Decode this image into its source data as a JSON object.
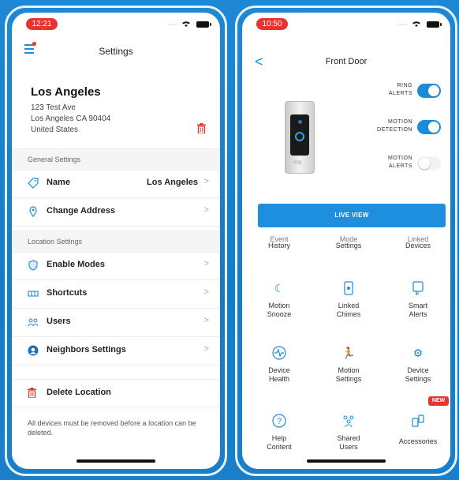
{
  "left": {
    "status_time": "12:21",
    "status_dots": "....",
    "nav_title": "Settings",
    "location": {
      "name": "Los Angeles",
      "address_line1": "123 Test Ave",
      "address_line2": "Los Angeles CA 90404",
      "address_line3": "United States"
    },
    "general_settings_header": "General Settings",
    "name_row": {
      "label": "Name",
      "value": "Los Angeles",
      "chevron": ">"
    },
    "change_address_row": {
      "label": "Change Address",
      "chevron": ">"
    },
    "location_settings_header": "Location Settings",
    "enable_modes_row": {
      "label": "Enable Modes",
      "chevron": ">"
    },
    "shortcuts_row": {
      "label": "Shortcuts",
      "chevron": ">"
    },
    "users_row": {
      "label": "Users",
      "chevron": ">"
    },
    "neighbors_row": {
      "label": "Neighbors Settings",
      "chevron": ">"
    },
    "delete_location_label": "Delete Location",
    "delete_note": "All devices must be removed before a location can be deleted."
  },
  "right": {
    "status_time": "10:50",
    "status_dots": "....",
    "nav_title": "Front Door",
    "back_glyph": "<",
    "doorbell_brand": "ring",
    "ring_alerts": {
      "label_1": "RING",
      "label_2": "ALERTS",
      "state": "on"
    },
    "motion_detection": {
      "label_1": "MOTION",
      "label_2": "DETECTION",
      "state": "on"
    },
    "motion_alerts": {
      "label_1": "MOTION",
      "label_2": "ALERTS",
      "state": "off"
    },
    "live_view_label": "LIVE VIEW",
    "tiles_row1": [
      {
        "cut": "Event",
        "label": "History"
      },
      {
        "cut": "Mode",
        "label": "Settings"
      },
      {
        "cut": "Linked",
        "label": "Devices"
      }
    ],
    "tiles_row2": [
      {
        "label_1": "Motion",
        "label_2": "Snooze",
        "icon": "moon-icon"
      },
      {
        "label_1": "Linked",
        "label_2": "Chimes",
        "icon": "chime-icon"
      },
      {
        "label_1": "Smart",
        "label_2": "Alerts",
        "icon": "smart-alert-icon"
      }
    ],
    "tiles_row3": [
      {
        "label_1": "Device",
        "label_2": "Health",
        "icon": "health-icon"
      },
      {
        "label_1": "Motion",
        "label_2": "Settings",
        "icon": "running-person-icon"
      },
      {
        "label_1": "Device",
        "label_2": "Settings",
        "icon": "gear-icon"
      }
    ],
    "tiles_row4": [
      {
        "label_1": "Help",
        "label_2": "Content",
        "icon": "help-icon"
      },
      {
        "label_1": "Shared",
        "label_2": "Users",
        "icon": "users-icon"
      },
      {
        "label_1": "Accessories",
        "label_2": "",
        "icon": "accessories-icon"
      }
    ],
    "new_badge": "NEW"
  },
  "colors": {
    "accent_blue": "#1d8bd6",
    "alert_red": "#e8342f",
    "background_blue": "#1d82cc"
  }
}
